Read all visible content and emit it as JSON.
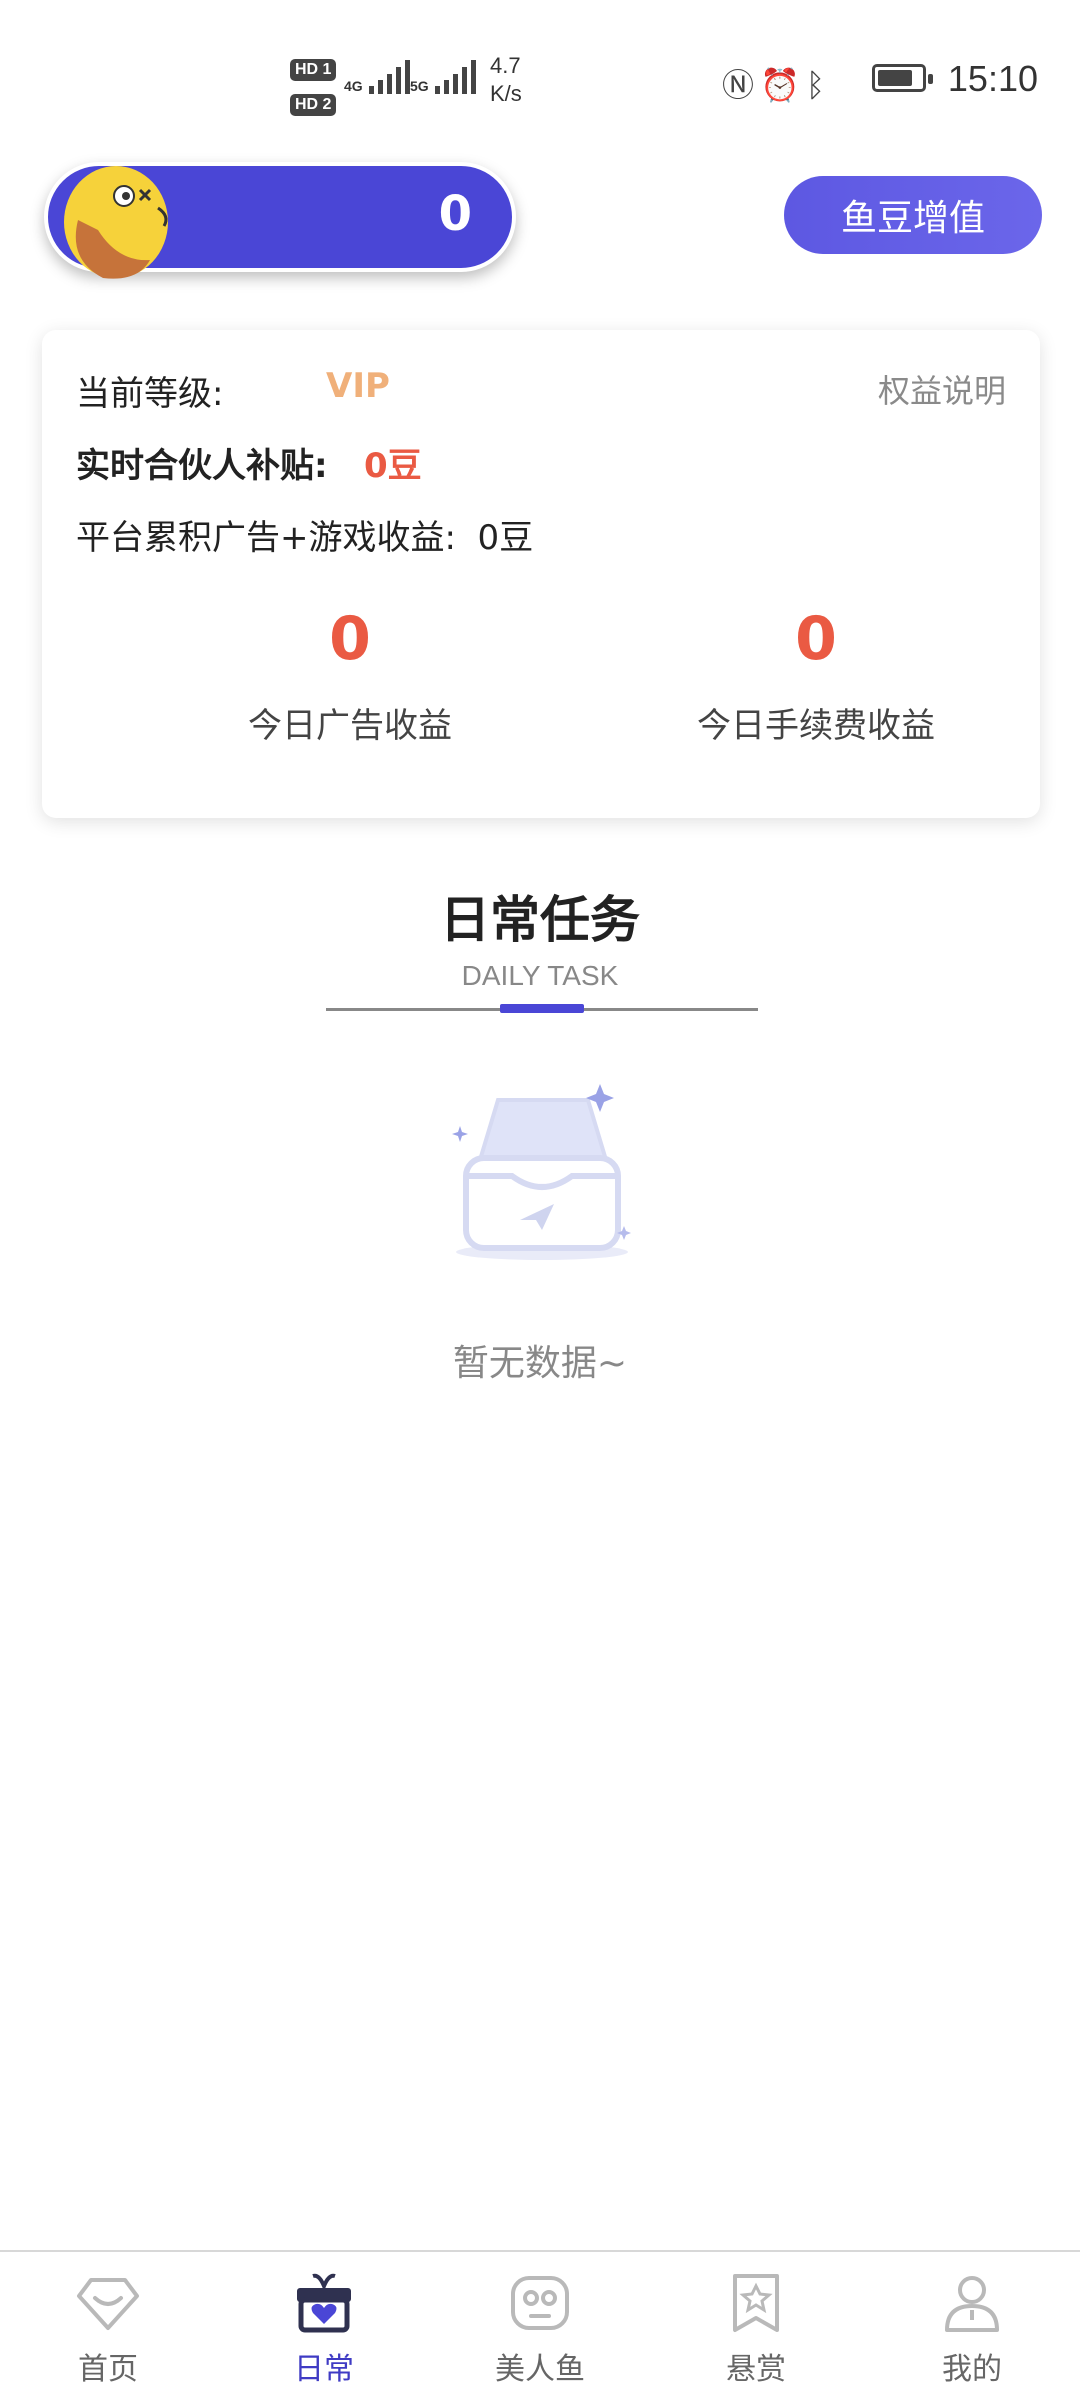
{
  "status_bar": {
    "sim1": "HD 1",
    "sim2": "HD 2",
    "net1": "4G",
    "net2": "5G",
    "speed_value": "4.7",
    "speed_unit": "K/s",
    "time": "15:10"
  },
  "header": {
    "balance_value": "0",
    "top_button_label": "鱼豆增值"
  },
  "card": {
    "level_label": "当前等级:",
    "level_value": "VIP",
    "benefits_link": "权益说明",
    "partner_subsidy_label": "实时合伙人补贴:",
    "partner_subsidy_value": "0豆",
    "platform_income_text": "平台累积广告+游戏收益:  0豆",
    "stats": [
      {
        "value": "0",
        "label": "今日广告收益"
      },
      {
        "value": "0",
        "label": "今日手续费收益"
      }
    ]
  },
  "section": {
    "title": "日常任务",
    "subtitle": "DAILY TASK"
  },
  "empty_state": {
    "text": "暂无数据~"
  },
  "bottom_nav": {
    "items": [
      {
        "label": "首页",
        "icon": "home-diamond-icon"
      },
      {
        "label": "日常",
        "icon": "gift-box-icon",
        "active": true
      },
      {
        "label": "美人鱼",
        "icon": "game-controller-icon"
      },
      {
        "label": "悬赏",
        "icon": "bookmark-star-icon"
      },
      {
        "label": "我的",
        "icon": "person-icon"
      }
    ]
  },
  "colors": {
    "primary": "#4a46d6",
    "accent_red": "#ea5a43",
    "vip_orange": "#f0b07a"
  }
}
